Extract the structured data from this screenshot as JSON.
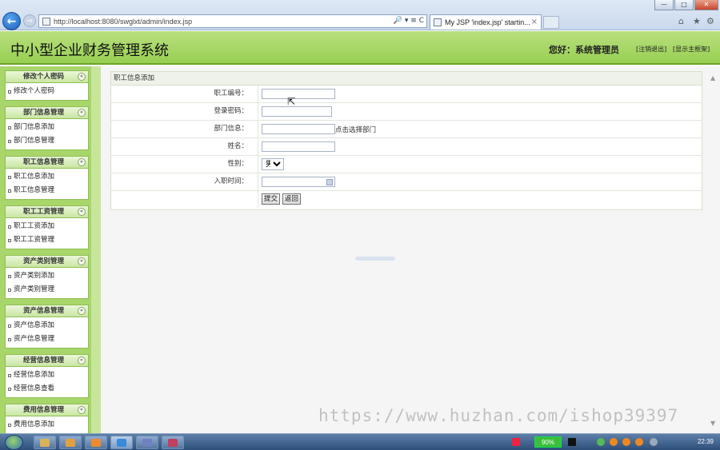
{
  "browser": {
    "url": "http://localhost:8080/swglxt/admin/index.jsp",
    "address_tools": "🔎 ▾ ≡ C",
    "tab_title": "My JSP 'index.jsp' startin...",
    "tab_close": "×",
    "back_glyph": "←",
    "forward_glyph": "→",
    "window_buttons": {
      "minimize": "—",
      "maximize": "□",
      "close": "✕"
    },
    "right_tools": {
      "home": "⌂",
      "favorites": "★",
      "settings": "⚙"
    }
  },
  "header": {
    "title": "中小型企业财务管理系统",
    "greeting": "您好：系统管理员",
    "logout": "[注销退出]",
    "home": "[显示主框架]"
  },
  "sidebar": {
    "groups": [
      {
        "title": "修改个人密码",
        "items": [
          "修改个人密码"
        ]
      },
      {
        "title": "部门信息管理",
        "items": [
          "部门信息添加",
          "部门信息管理"
        ]
      },
      {
        "title": "职工信息管理",
        "items": [
          "职工信息添加",
          "职工信息管理"
        ]
      },
      {
        "title": "职工工资管理",
        "items": [
          "职工工资添加",
          "职工工资管理"
        ]
      },
      {
        "title": "资产类别管理",
        "items": [
          "资产类别添加",
          "资产类别管理"
        ]
      },
      {
        "title": "资产信息管理",
        "items": [
          "资产信息添加",
          "资产信息管理"
        ]
      },
      {
        "title": "经营信息管理",
        "items": [
          "经营信息添加",
          "经营信息查看"
        ]
      },
      {
        "title": "费用信息管理",
        "items": [
          "费用信息添加"
        ]
      }
    ],
    "collapse_glyph": "«"
  },
  "form": {
    "panel_title": "职工信息添加",
    "fields": {
      "emp_no": {
        "label": "职工编号：",
        "value": ""
      },
      "password": {
        "label": "登录密码：",
        "value": ""
      },
      "department": {
        "label": "部门信息：",
        "value": "",
        "hint": "点击选择部门"
      },
      "name": {
        "label": "姓名：",
        "value": ""
      },
      "gender": {
        "label": "性别：",
        "selected": "男"
      },
      "hire_date": {
        "label": "入职时间：",
        "value": ""
      }
    },
    "submit_label": "提交",
    "back_label": "返回"
  },
  "scrollbar": {
    "up": "▲",
    "down": "▼"
  },
  "watermark": "https://www.huzhan.com/ishop39397",
  "taskbar": {
    "battery": "90%",
    "clock": "22:39"
  }
}
